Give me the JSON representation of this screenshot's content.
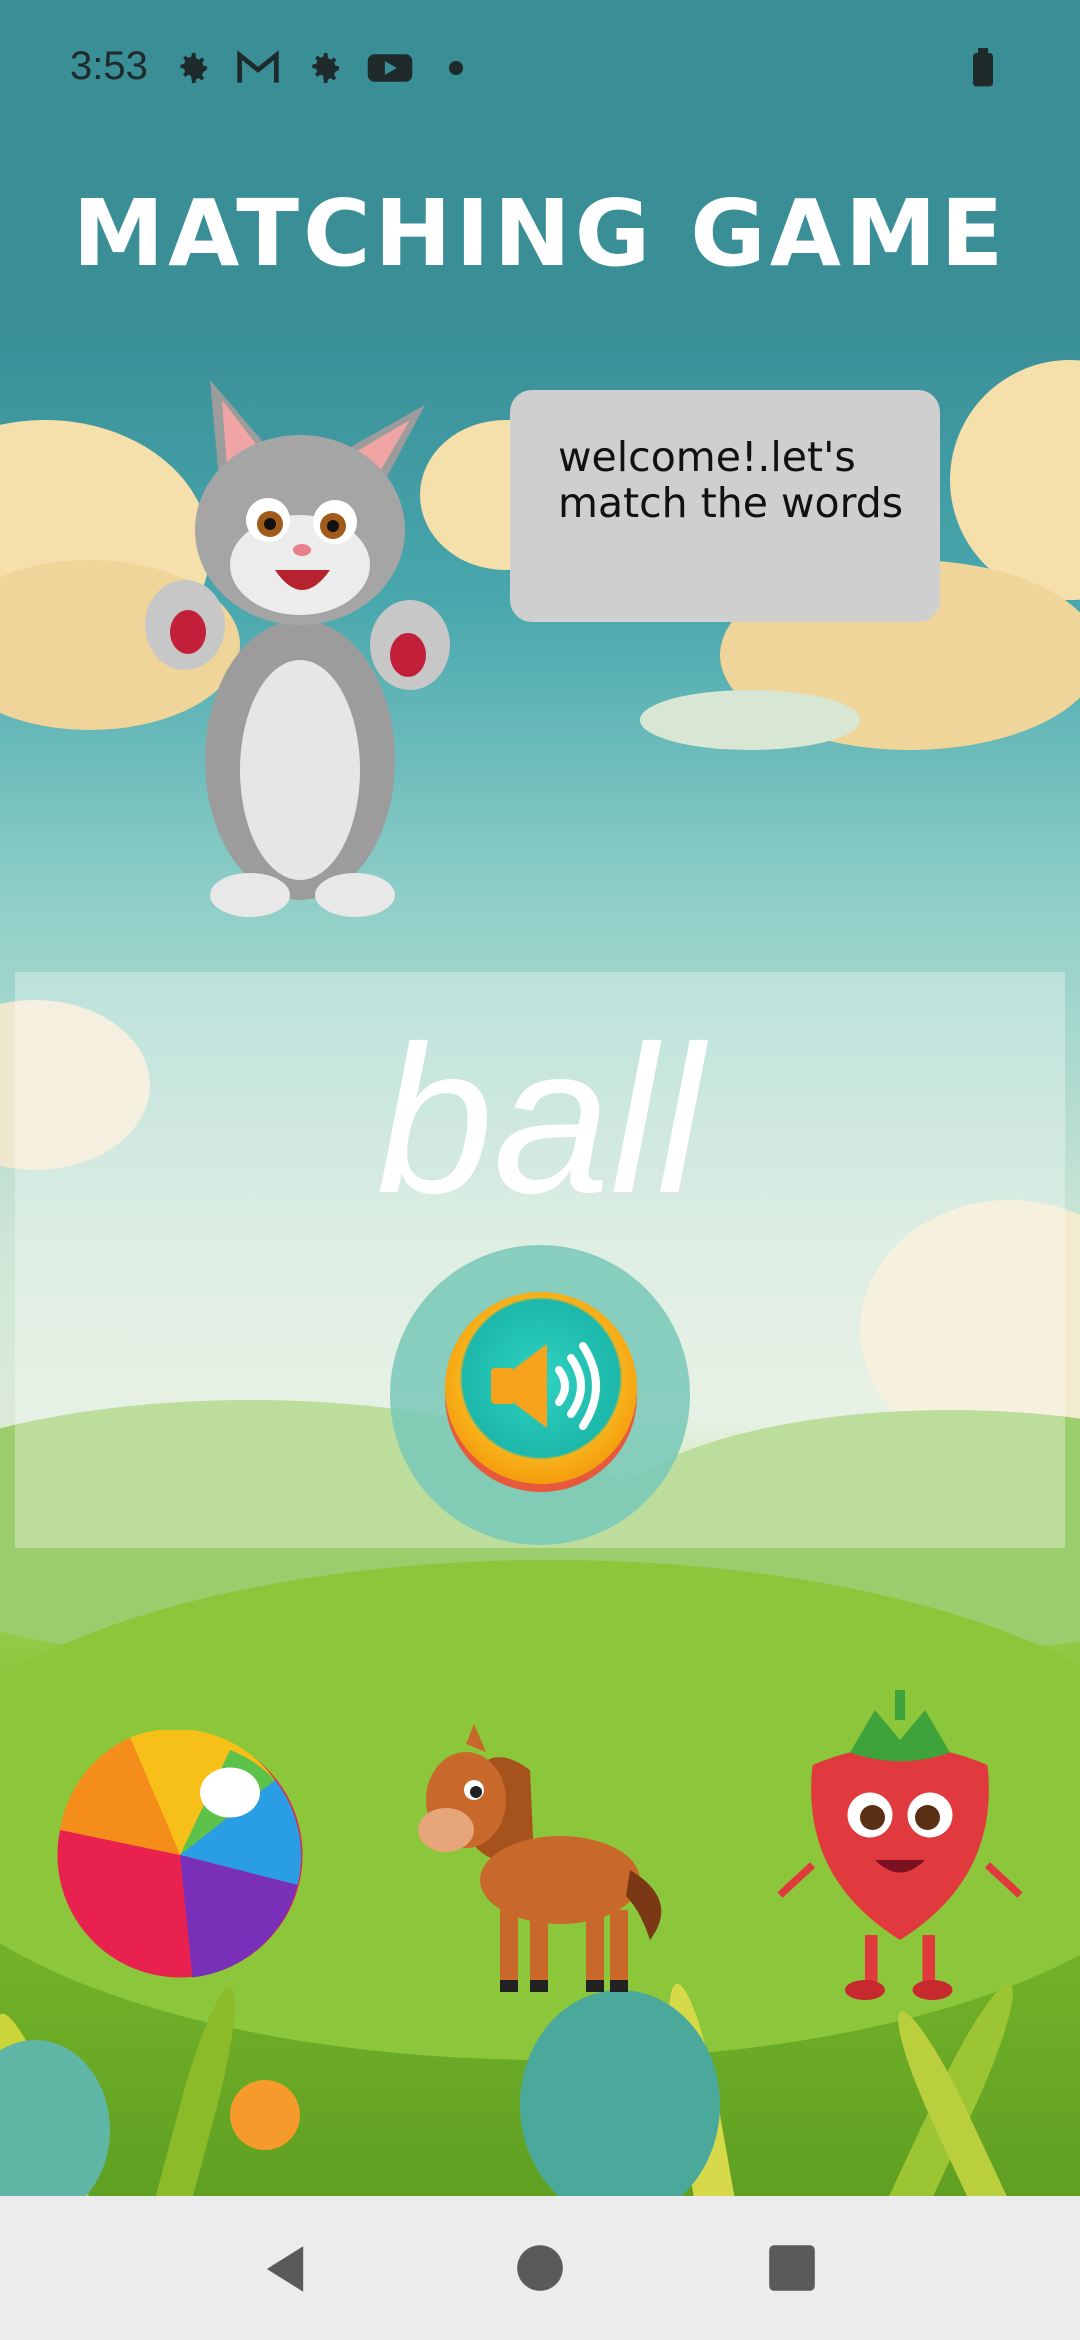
{
  "status_bar": {
    "time": "3:53",
    "icons": [
      "gear-icon",
      "gmail-icon",
      "gear-icon",
      "youtube-icon",
      "dot-icon",
      "battery-icon"
    ]
  },
  "title": "MATCHING GAME",
  "speech_bubble": {
    "text": "Welcome!.Let's match the words"
  },
  "word_card": {
    "word": "ball",
    "sound_button_icon": "speaker-icon"
  },
  "options": [
    {
      "name": "ball",
      "icon": "beach-ball-icon"
    },
    {
      "name": "horse",
      "icon": "horse-icon"
    },
    {
      "name": "strawberry",
      "icon": "strawberry-icon"
    }
  ],
  "nav_bar": {
    "icons": [
      "back-icon",
      "home-icon",
      "recents-icon"
    ]
  },
  "colors": {
    "header": "#3a8f97",
    "bubble": "#cfcfcf",
    "grass": "#7fbd2c"
  }
}
